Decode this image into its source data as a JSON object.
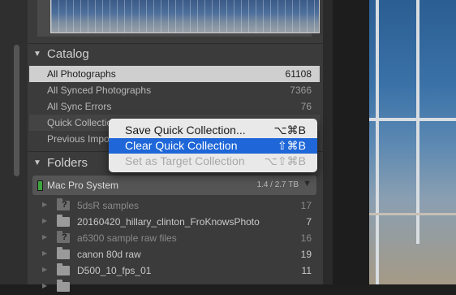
{
  "catalog": {
    "title": "Catalog",
    "items": [
      {
        "label": "All Photographs",
        "count": "61108"
      },
      {
        "label": "All Synced Photographs",
        "count": "7366"
      },
      {
        "label": "All Sync Errors",
        "count": "76"
      },
      {
        "label": "Quick Collection",
        "count": ""
      },
      {
        "label": "Previous Import",
        "count": ""
      }
    ]
  },
  "folders": {
    "title": "Folders",
    "volume": {
      "name": "Mac Pro System",
      "size": "1.4 / 2.7 TB"
    },
    "items": [
      {
        "label": "5dsR samples",
        "count": "17"
      },
      {
        "label": "20160420_hillary_clinton_FroKnowsPhoto",
        "count": "7"
      },
      {
        "label": "a6300 sample raw files",
        "count": "16"
      },
      {
        "label": "canon 80d raw",
        "count": "19"
      },
      {
        "label": "D500_10_fps_01",
        "count": "11"
      }
    ]
  },
  "context_menu": {
    "items": [
      {
        "label": "Save Quick Collection...",
        "shortcut": "⌥⌘B"
      },
      {
        "label": "Clear Quick Collection",
        "shortcut": "⇧⌘B"
      },
      {
        "label": "Set as Target Collection",
        "shortcut": "⌥⇧⌘B"
      }
    ]
  },
  "icons": {
    "section_toggle": "disclosure-triangle-icon",
    "folder": "folder-icon",
    "missing_folder": "missing-folder-icon",
    "volume_status": "volume-status-led-icon",
    "volume_menu": "volume-menu-arrow-icon"
  },
  "colors": {
    "menu_highlight": "#1f67d8",
    "selected_row": "#cfcfcf",
    "volume_led": "#3ea43e"
  }
}
